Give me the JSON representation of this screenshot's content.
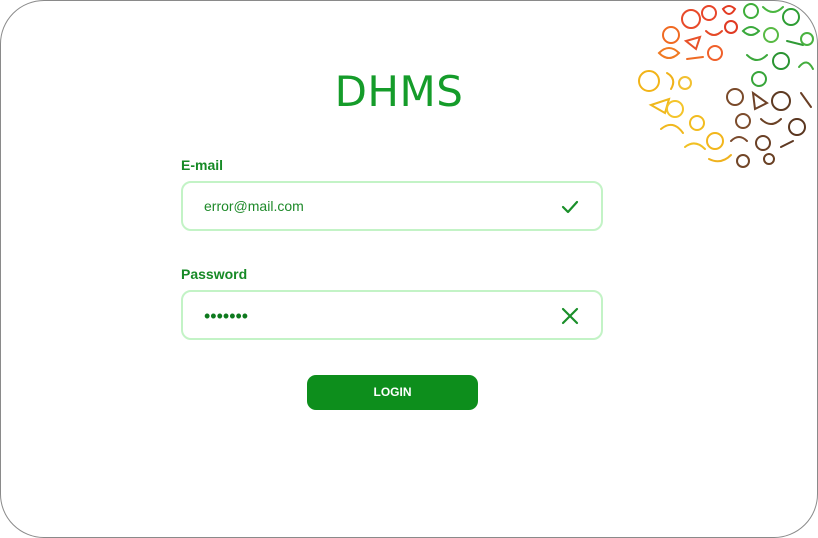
{
  "app": {
    "title": "DHMS"
  },
  "colors": {
    "accent": "#0d8e1c",
    "text_green": "#168a26",
    "field_border": "#c3f3c6",
    "valid_icon": "#1a8f2a",
    "invalid_icon": "#1a8f2a"
  },
  "form": {
    "email": {
      "label": "E-mail",
      "value": "error@mail.com",
      "status_icon": "check-icon"
    },
    "password": {
      "label": "Password",
      "value": "•••••••",
      "status_icon": "close-icon"
    },
    "login_label": "LOGIN"
  },
  "decoration": {
    "icon": "vegetables-illustration"
  }
}
